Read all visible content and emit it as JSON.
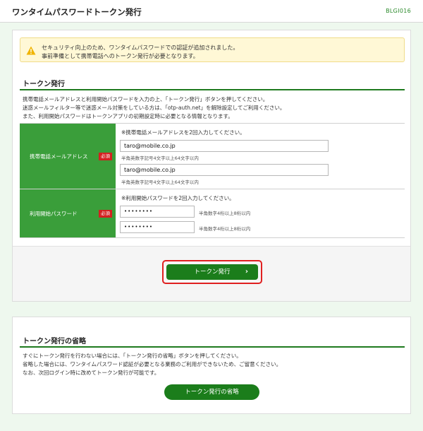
{
  "header": {
    "title": "ワンタイムパスワードトークン発行",
    "screen_code": "BLGI016"
  },
  "warning": {
    "icon": "warning-icon",
    "line1": "セキュリティ向上のため、ワンタイムパスワードでの認証が追加されました。",
    "line2": "事前準備として携帯電話へのトークン発行が必要となります。"
  },
  "token_issue": {
    "heading": "トークン発行",
    "desc1": "携帯電話メールアドレスと利用開始パスワードを入力の上、「トークン発行」ボタンを押してください。",
    "desc2": "迷惑メールフィルター等で迷惑メール対策をしている方は、「otp-auth.net」を解除設定してご利用ください。",
    "desc3": "また、利用開始パスワードはトークンアプリの初期設定時に必要となる情報となります。",
    "required_badge": "必須",
    "email": {
      "label": "携帯電話メールアドレス",
      "note": "※携帯電話メールアドレスを2回入力してください。",
      "value1": "taro@mobile.co.jp",
      "hint1": "半角英数字記号4文字以上64文字以内",
      "value2": "taro@mobile.co.jp",
      "hint2": "半角英数字記号4文字以上64文字以内"
    },
    "password": {
      "label": "利用開始パスワード",
      "note": "※利用開始パスワードを2回入力してください。",
      "value1": "••••••••",
      "hint1": "半角数字4桁以上8桁以内",
      "value2": "••••••••",
      "hint2": "半角数字4桁以上8桁以内"
    },
    "button_label": "トークン発行",
    "button_arrow": "›"
  },
  "skip": {
    "heading": "トークン発行の省略",
    "desc1": "すぐにトークン発行を行わない場合には、「トークン発行の省略」ボタンを押してください。",
    "desc2": "省略した場合には、ワンタイムパスワード認証が必要となる業務のご利用ができないため、ご留意ください。",
    "desc3": "なお、次回ログイン時に改めてトークン発行が可能です。",
    "button_label": "トークン発行の省略"
  },
  "colors": {
    "accent_green": "#1b7d1b",
    "label_green": "#3a9e3a",
    "required_red": "#d42020",
    "highlight_red": "#e02020",
    "warning_bg": "#fff8d6"
  }
}
